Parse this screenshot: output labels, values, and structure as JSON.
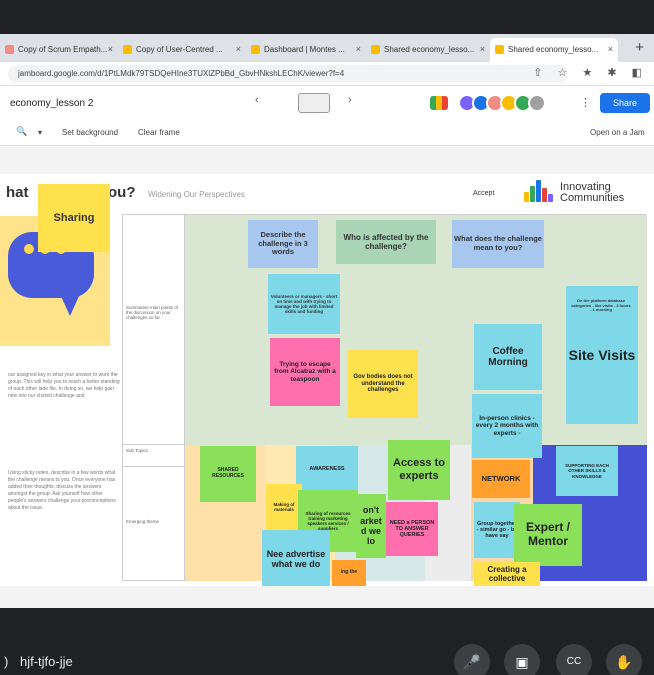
{
  "browser": {
    "tabs": [
      {
        "label": "Copy of Scrum Empath...",
        "color": "#f28b82"
      },
      {
        "label": "Copy of User-Centred ...",
        "color": "#fbbc04"
      },
      {
        "label": "Dashboard | Montes ...",
        "color": "#fbbc04"
      },
      {
        "label": "Shared economy_lesso...",
        "color": "#fbbc04"
      },
      {
        "label": "Shared economy_lesso...",
        "color": "#fbbc04"
      }
    ],
    "tab_close": "×",
    "new_tab": "+",
    "url": "jamboard.google.com/d/1PtLMdk79TSDQeHIne3TUXlZPbBd_GbvHNkshLEChK/viewer?f=4",
    "url_icons": "⇧ ☆ ★ ✱ ◧"
  },
  "app": {
    "doc_title": "economy_lesson 2",
    "frame_prev": "‹",
    "frame_next": "›",
    "kebab": "⋮",
    "share_label": "Share",
    "avatar_colors": [
      "#7b61ff",
      "#1a73e8",
      "#f28b82",
      "#fbbc04",
      "#34a853",
      "#a0a0a0"
    ]
  },
  "toolbar": {
    "zoom_icon": "🔍",
    "zoom_caret": "▾",
    "set_background": "Set background",
    "clear_frame": "Clear frame",
    "open_in_jam": "Open on a Jam"
  },
  "slide": {
    "heading_left": "hat",
    "heading_right": "ou?",
    "subtitle": "Widening Our Perspectives",
    "accept": "Accept",
    "logo_text_1": "Innovating",
    "logo_text_2": "Communities",
    "left_text_1": "our assigned key in what your answer to work the group. This will help you to reach a better standing of each other lade file. In doing so, we help gain new into our shared challenge and",
    "left_text_2": "Using sticky notes, describe in a few words what the challenge means to you. Once everyone has added their thoughts, discuss the answers amongst the group. Ask yourself how other people's answers challenge your preconceptions about the issue.",
    "row_labels": {
      "summary": "Summarise main points of the discussion on your challenges so far",
      "sub_topics": "Sub Topics",
      "emerging": "Emerging theme"
    }
  },
  "notes": {
    "sharing": "Sharing",
    "describe": "Describe the challenge in 3 words",
    "who": "Who is affected by the challenge?",
    "what_mean": "What does the challenge mean to you?",
    "small_blue": "Volunteers or managers - short on time and with trying to manage the job with limited skills and funding",
    "trying": "Trying to escape from Alcatraz with a teaspoon",
    "gov": "Gov bodies does not understand the challenges",
    "coffee": "Coffee Morning",
    "inperson": "In-person clinics - every 2 months with experts -",
    "site": "Site Visits",
    "cyan_small": "On the platform database categories - like visits - 3 hours - 1 morning",
    "shared_res": "SHARED RESOURCES",
    "awareness": "AWARENESS",
    "nted": "nted",
    "making": "Making of materials",
    "sharing_res": "Sharing of resources training marketing speakers services / suppliers",
    "need_adv": "Nee advertise what we do",
    "dont": "on't arket d we lo",
    "access": "Access to experts",
    "need_person": "NEED a PERSON TO ANSWER QUERIES",
    "network": "NETWORK",
    "group": "Group together - similar go - be have say",
    "expert": "Expert / Mentor",
    "creating": "Creating a collective",
    "supporting": "SUPPORTING EACH OTHER SKILLS & KNOWLEDGE",
    "lng": "ing the"
  },
  "meet": {
    "separator": ")",
    "code": "hjf-tjfo-jje",
    "mic_icon": "🎤",
    "cam_icon": "▣",
    "cc_icon": "CC",
    "hand_icon": "✋"
  }
}
